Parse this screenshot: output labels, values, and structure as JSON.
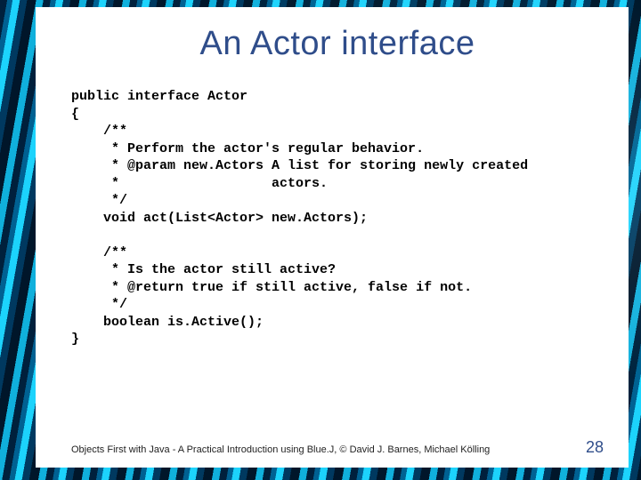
{
  "title": "An Actor interface",
  "code": "public interface Actor\n{\n    /**\n     * Perform the actor's regular behavior.\n     * @param new.Actors A list for storing newly created\n     *                   actors.\n     */\n    void act(List<Actor> new.Actors);\n\n    /**\n     * Is the actor still active?\n     * @return true if still active, false if not.\n     */\n    boolean is.Active();\n}",
  "footer": "Objects First with Java - A Practical Introduction using Blue.J, © David J. Barnes, Michael Kölling",
  "page": "28"
}
